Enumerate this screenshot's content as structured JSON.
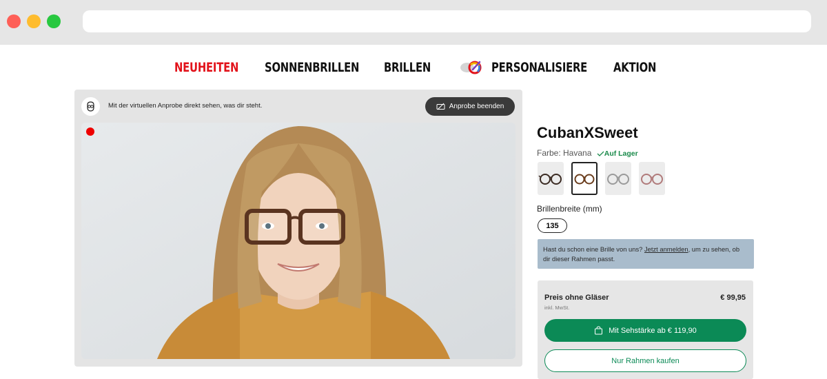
{
  "nav": {
    "items": [
      {
        "label": "NEUHEITEN",
        "active": true
      },
      {
        "label": "SONNENBRILLEN",
        "active": false
      },
      {
        "label": "BRILLEN",
        "active": false
      },
      {
        "label": "PERSONALISIERE",
        "active": false
      },
      {
        "label": "AKTION",
        "active": false
      }
    ]
  },
  "tryon": {
    "hint": "Mit der virtuellen Anprobe direkt sehen, was dir steht.",
    "end_button": "Anprobe beenden"
  },
  "product": {
    "name": "CubanXSweet",
    "color_label": "Farbe: Havana",
    "stock": "Auf Lager",
    "swatches": [
      {
        "name": "schwarz-havana",
        "color": "#3a2a22"
      },
      {
        "name": "havana",
        "color": "#6b3e1e",
        "selected": true
      },
      {
        "name": "grau-transparent",
        "color": "#9a9a9a"
      },
      {
        "name": "rose",
        "color": "#b07a7a"
      }
    ],
    "width_label": "Brillenbreite (mm)",
    "width_value": "135"
  },
  "login_box": {
    "text_before": "Hast du schon eine Brille von uns? ",
    "link": "Jetzt anmelden",
    "text_after": ", um zu sehen, ob dir dieser Rahmen passt."
  },
  "price": {
    "label": "Preis ohne Gläser",
    "value": "€ 99,95",
    "vat": "inkl. MwSt.",
    "buy_label": "Mit Sehstärke ab € 119,90",
    "frame_label": "Nur Rahmen kaufen"
  },
  "colors": {
    "accent_red": "#e2131b",
    "brand_green": "#0b8a56",
    "stock_green": "#1a8a4a"
  }
}
